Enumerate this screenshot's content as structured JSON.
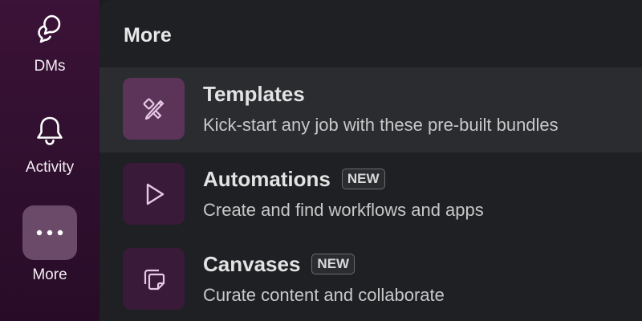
{
  "sidebar": {
    "items": [
      {
        "label": "DMs",
        "icon": "dms-icon"
      },
      {
        "label": "Activity",
        "icon": "bell-icon"
      },
      {
        "label": "More",
        "icon": "ellipsis-icon",
        "selected": true
      }
    ]
  },
  "panel": {
    "title": "More",
    "items": [
      {
        "title": "Templates",
        "description": "Kick-start any job with these pre-built bundles",
        "badge": "",
        "icon": "templates-icon",
        "highlighted": true
      },
      {
        "title": "Automations",
        "description": "Create and find workflows and apps",
        "badge": "NEW",
        "icon": "play-icon"
      },
      {
        "title": "Canvases",
        "description": "Curate content and collaborate",
        "badge": "NEW",
        "icon": "canvas-icon"
      }
    ]
  },
  "colors": {
    "rail_bg": "#3b1238",
    "panel_bg": "#1e2023",
    "highlight_row": "#2a2c30",
    "tile_active": "#5c3459",
    "tile_dark": "#3a1a39",
    "icon_tint": "#e6c9e4"
  }
}
